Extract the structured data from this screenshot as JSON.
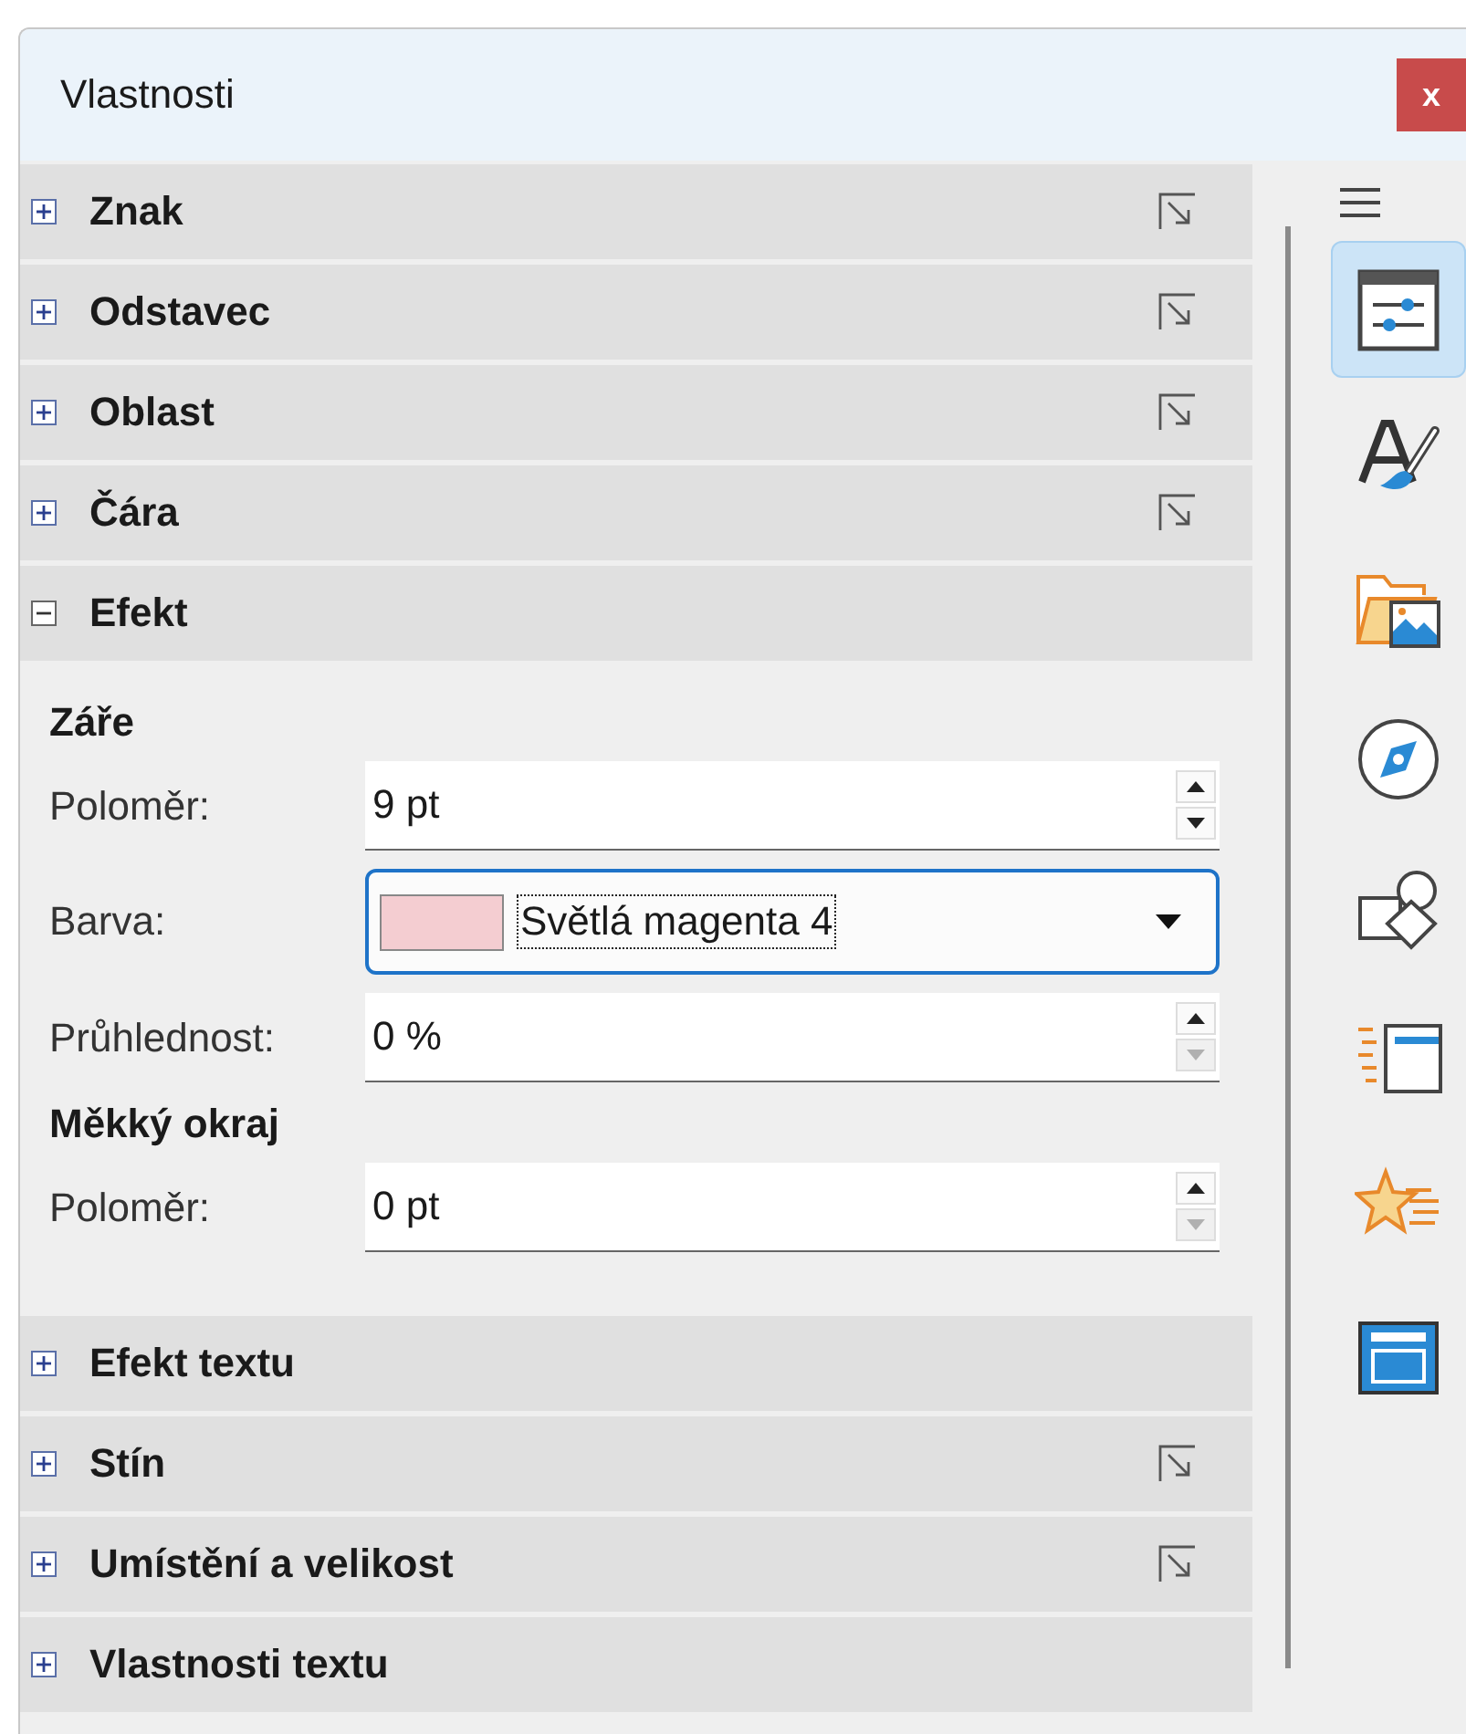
{
  "window": {
    "title": "Vlastnosti",
    "close": "x"
  },
  "sections": [
    {
      "title": "Znak",
      "expanded": false,
      "has_more_options": true
    },
    {
      "title": "Odstavec",
      "expanded": false,
      "has_more_options": true
    },
    {
      "title": "Oblast",
      "expanded": false,
      "has_more_options": true
    },
    {
      "title": "Čára",
      "expanded": false,
      "has_more_options": true
    },
    {
      "title": "Efekt",
      "expanded": true,
      "has_more_options": false,
      "groups": [
        {
          "title": "Záře",
          "fields": [
            {
              "kind": "spin",
              "label": "Poloměr:",
              "value": "9 pt",
              "down_disabled": false
            },
            {
              "kind": "color",
              "label": "Barva:",
              "value": "Světlá magenta 4",
              "color": "#f4cdd1",
              "focused": true
            },
            {
              "kind": "spin",
              "label": "Průhlednost:",
              "value": "0 %",
              "down_disabled": true
            }
          ]
        },
        {
          "title": "Měkký okraj",
          "fields": [
            {
              "kind": "spin",
              "label": "Poloměr:",
              "value": "0 pt",
              "down_disabled": true
            }
          ]
        }
      ]
    },
    {
      "title": "Efekt textu",
      "expanded": false,
      "has_more_options": false
    },
    {
      "title": "Stín",
      "expanded": false,
      "has_more_options": true
    },
    {
      "title": "Umístění a velikost",
      "expanded": false,
      "has_more_options": true
    },
    {
      "title": "Vlastnosti textu",
      "expanded": false,
      "has_more_options": false
    }
  ],
  "tabs": [
    {
      "kind": "properties",
      "selected": true
    },
    {
      "kind": "styles",
      "selected": false
    },
    {
      "kind": "gallery",
      "selected": false
    },
    {
      "kind": "navigator",
      "selected": false
    },
    {
      "kind": "shapes",
      "selected": false
    },
    {
      "kind": "animation",
      "selected": false
    },
    {
      "kind": "effects",
      "selected": false
    },
    {
      "kind": "design",
      "selected": false
    }
  ]
}
